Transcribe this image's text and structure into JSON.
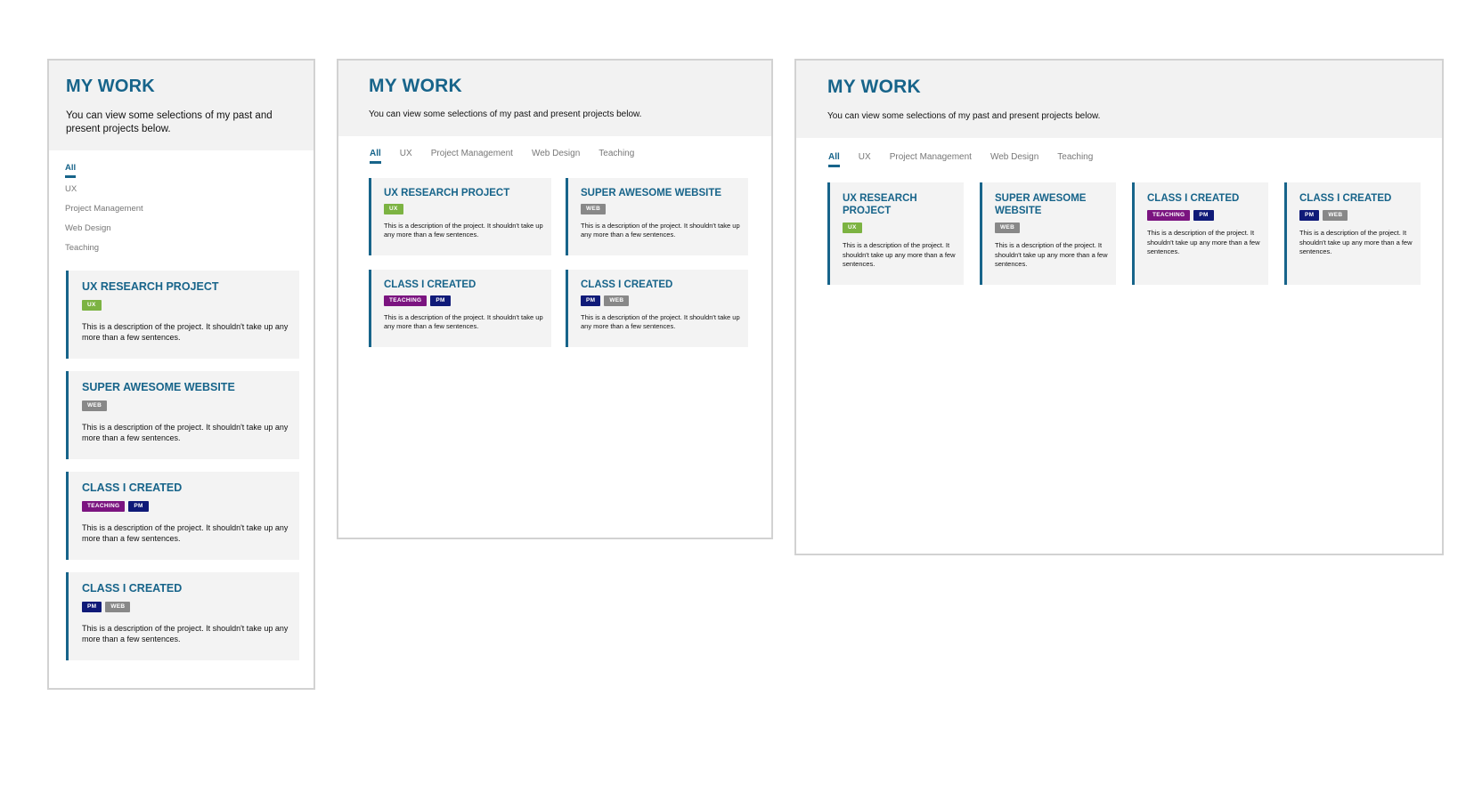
{
  "header": {
    "title": "MY WORK",
    "description": "You can view some selections of my past and present projects below."
  },
  "filters": [
    "All",
    "UX",
    "Project Management",
    "Web Design",
    "Teaching"
  ],
  "active_filter": "All",
  "projects": [
    {
      "title": "UX RESEARCH PROJECT",
      "tags": [
        {
          "label": "UX",
          "kind": "ux"
        }
      ],
      "description": "This is a description of the project. It shouldn't take up any more than a few sentences."
    },
    {
      "title": "SUPER AWESOME WEBSITE",
      "tags": [
        {
          "label": "WEB",
          "kind": "web"
        }
      ],
      "description": "This is a description of the project. It shouldn't take up any more than a few sentences."
    },
    {
      "title": "CLASS I CREATED",
      "tags": [
        {
          "label": "TEACHING",
          "kind": "teaching"
        },
        {
          "label": "PM",
          "kind": "pm"
        }
      ],
      "description": "This is a description of the project. It shouldn't take up any more than a few sentences."
    },
    {
      "title": "CLASS I CREATED",
      "tags": [
        {
          "label": "PM",
          "kind": "pm"
        },
        {
          "label": "WEB",
          "kind": "web"
        }
      ],
      "description": "This is a description of the project. It shouldn't take up any more than a few sentences."
    }
  ],
  "colors": {
    "accent": "#17648a",
    "ux": "#7cb342",
    "web": "#888888",
    "teaching": "#7b1480",
    "pm": "#0f1a78",
    "card_bg": "#f3f3f3",
    "header_bg": "#f2f2f2"
  }
}
